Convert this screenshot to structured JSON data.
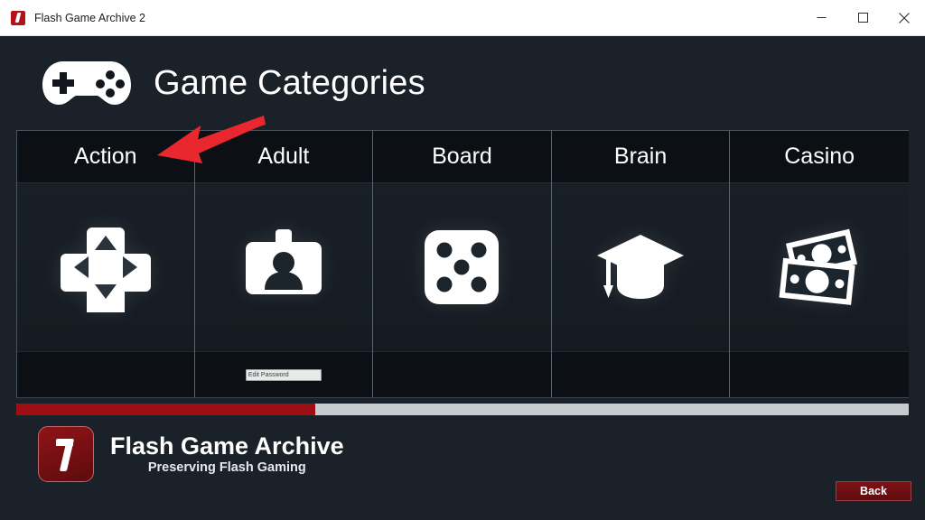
{
  "window": {
    "title": "Flash Game Archive 2",
    "app_icon": "flash-logo-icon",
    "controls": {
      "minimize": "minimize-icon",
      "maximize": "maximize-icon",
      "close": "close-icon"
    }
  },
  "header": {
    "icon": "gamepad-icon",
    "title": "Game Categories"
  },
  "annotation": {
    "arrow": "red-arrow-pointing-left",
    "arrow_color": "#e8272f",
    "target": "Action"
  },
  "categories": [
    {
      "label": "Action",
      "icon": "dpad-icon",
      "field_text": ""
    },
    {
      "label": "Adult",
      "icon": "id-badge-icon",
      "field_text": "Edit Password"
    },
    {
      "label": "Board",
      "icon": "dice-five-icon",
      "field_text": ""
    },
    {
      "label": "Brain",
      "icon": "graduation-cap-icon",
      "field_text": ""
    },
    {
      "label": "Casino",
      "icon": "banknotes-icon",
      "field_text": ""
    }
  ],
  "scrollbar": {
    "orientation": "horizontal",
    "thumb_percent": 33.5,
    "thumb_color": "#9d0f12",
    "track_color": "#c9ccce"
  },
  "brand": {
    "logo": "flash-logo-icon",
    "name": "Flash Game Archive",
    "tagline": "Preserving Flash Gaming"
  },
  "footer": {
    "back_label": "Back",
    "back_color": "#6e1014"
  },
  "theme": {
    "background": "#1b2129",
    "tile_header": "#0c0f14",
    "accent_red": "#9d0f12",
    "text": "#ffffff"
  }
}
